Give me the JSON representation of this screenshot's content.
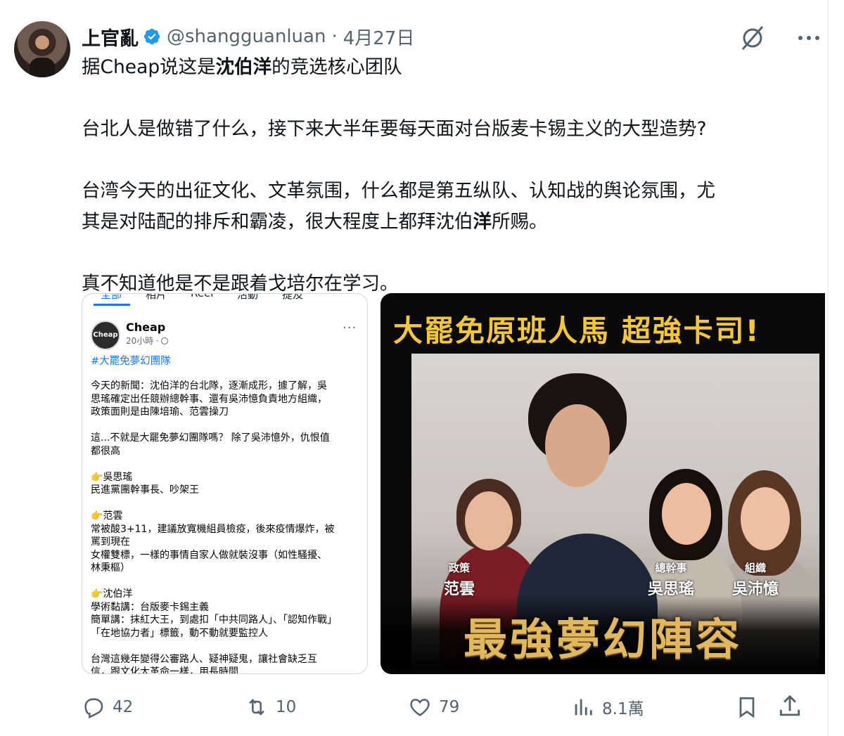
{
  "author": {
    "display_name": "上官亂",
    "handle": "@shangguanluan",
    "separator": "·",
    "date": "4月27日"
  },
  "tweet": {
    "line1_pre": "据Cheap说这是",
    "line1_bold": "沈伯洋",
    "line1_post": "的竞选核心团队",
    "line2": "台北人是做错了什么，接下来大半年要每天面对台版麦卡锡主义的大型造势?",
    "line3": "台湾今天的出征文化、文革氛围，什么都是第五纵队、认知战的舆论氛围，尤",
    "line4_pre": "其是对陆配的排斥和霸凌，很大程度上都拜沈伯",
    "line4_bold": "洋",
    "line4_post": "所赐。",
    "line5": "真不知道他是不是跟着戈培尔在学习。"
  },
  "fb_post": {
    "tabs": [
      "全部",
      "相片",
      "Reel",
      "活動",
      "提及"
    ],
    "avatar_text": "Cheap",
    "page_name": "Cheap",
    "time": "20小時 ·",
    "more": "···",
    "hashtag": "#大罷免夢幻團隊",
    "body": [
      "今天的新聞：沈伯洋的台北隊，逐漸成形，據了解，吳",
      "思瑤確定出任競辦總幹事、還有吳沛憶負責地方組織，",
      "政策面則是由陳培瑜、范雲操刀",
      "",
      "這...不就是大罷免夢幻團隊嗎？ 除了吳沛憶外，仇恨值",
      "都很高",
      "",
      "👉吳思瑤",
      "民進黨團幹事長、吵架王",
      "",
      "👉范雲",
      "常被酸3+11，建議放寬機組員檢疫，後來疫情爆炸，被",
      "罵到現在",
      "女權雙標，一樣的事情自家人做就裝沒事（如性騷擾、",
      "林秉樞）",
      "",
      "👉沈伯洋",
      "學術黏講：台版麥卡錫主義",
      "簡單講：抹紅大王，到處扣「中共同路人」、「認知作戰」",
      "「在地協力者」標籤，動不動就要監控人",
      "",
      "台灣這幾年變得公審路人、疑神疑鬼，讓社會缺乏互",
      "信，跟文化大革命一樣，用長時間..."
    ]
  },
  "promo": {
    "title": "大罷免原班人馬 超強卡司!",
    "roles": [
      {
        "title": "政策",
        "name": "范雲"
      },
      {
        "title": "總幹事",
        "name": "吳思瑤"
      },
      {
        "title": "組織",
        "name": "吳沛憶"
      }
    ],
    "subtitle": "最強夢幻陣容"
  },
  "actions": {
    "replies": "42",
    "retweets": "10",
    "likes": "79",
    "views": "8.1萬"
  },
  "colors": {
    "verified": "#1d9bf0",
    "muted": "#536471",
    "fb_blue": "#1877f2",
    "promo_yellow": "#f3c832",
    "promo_gold": "#e2b85c"
  }
}
